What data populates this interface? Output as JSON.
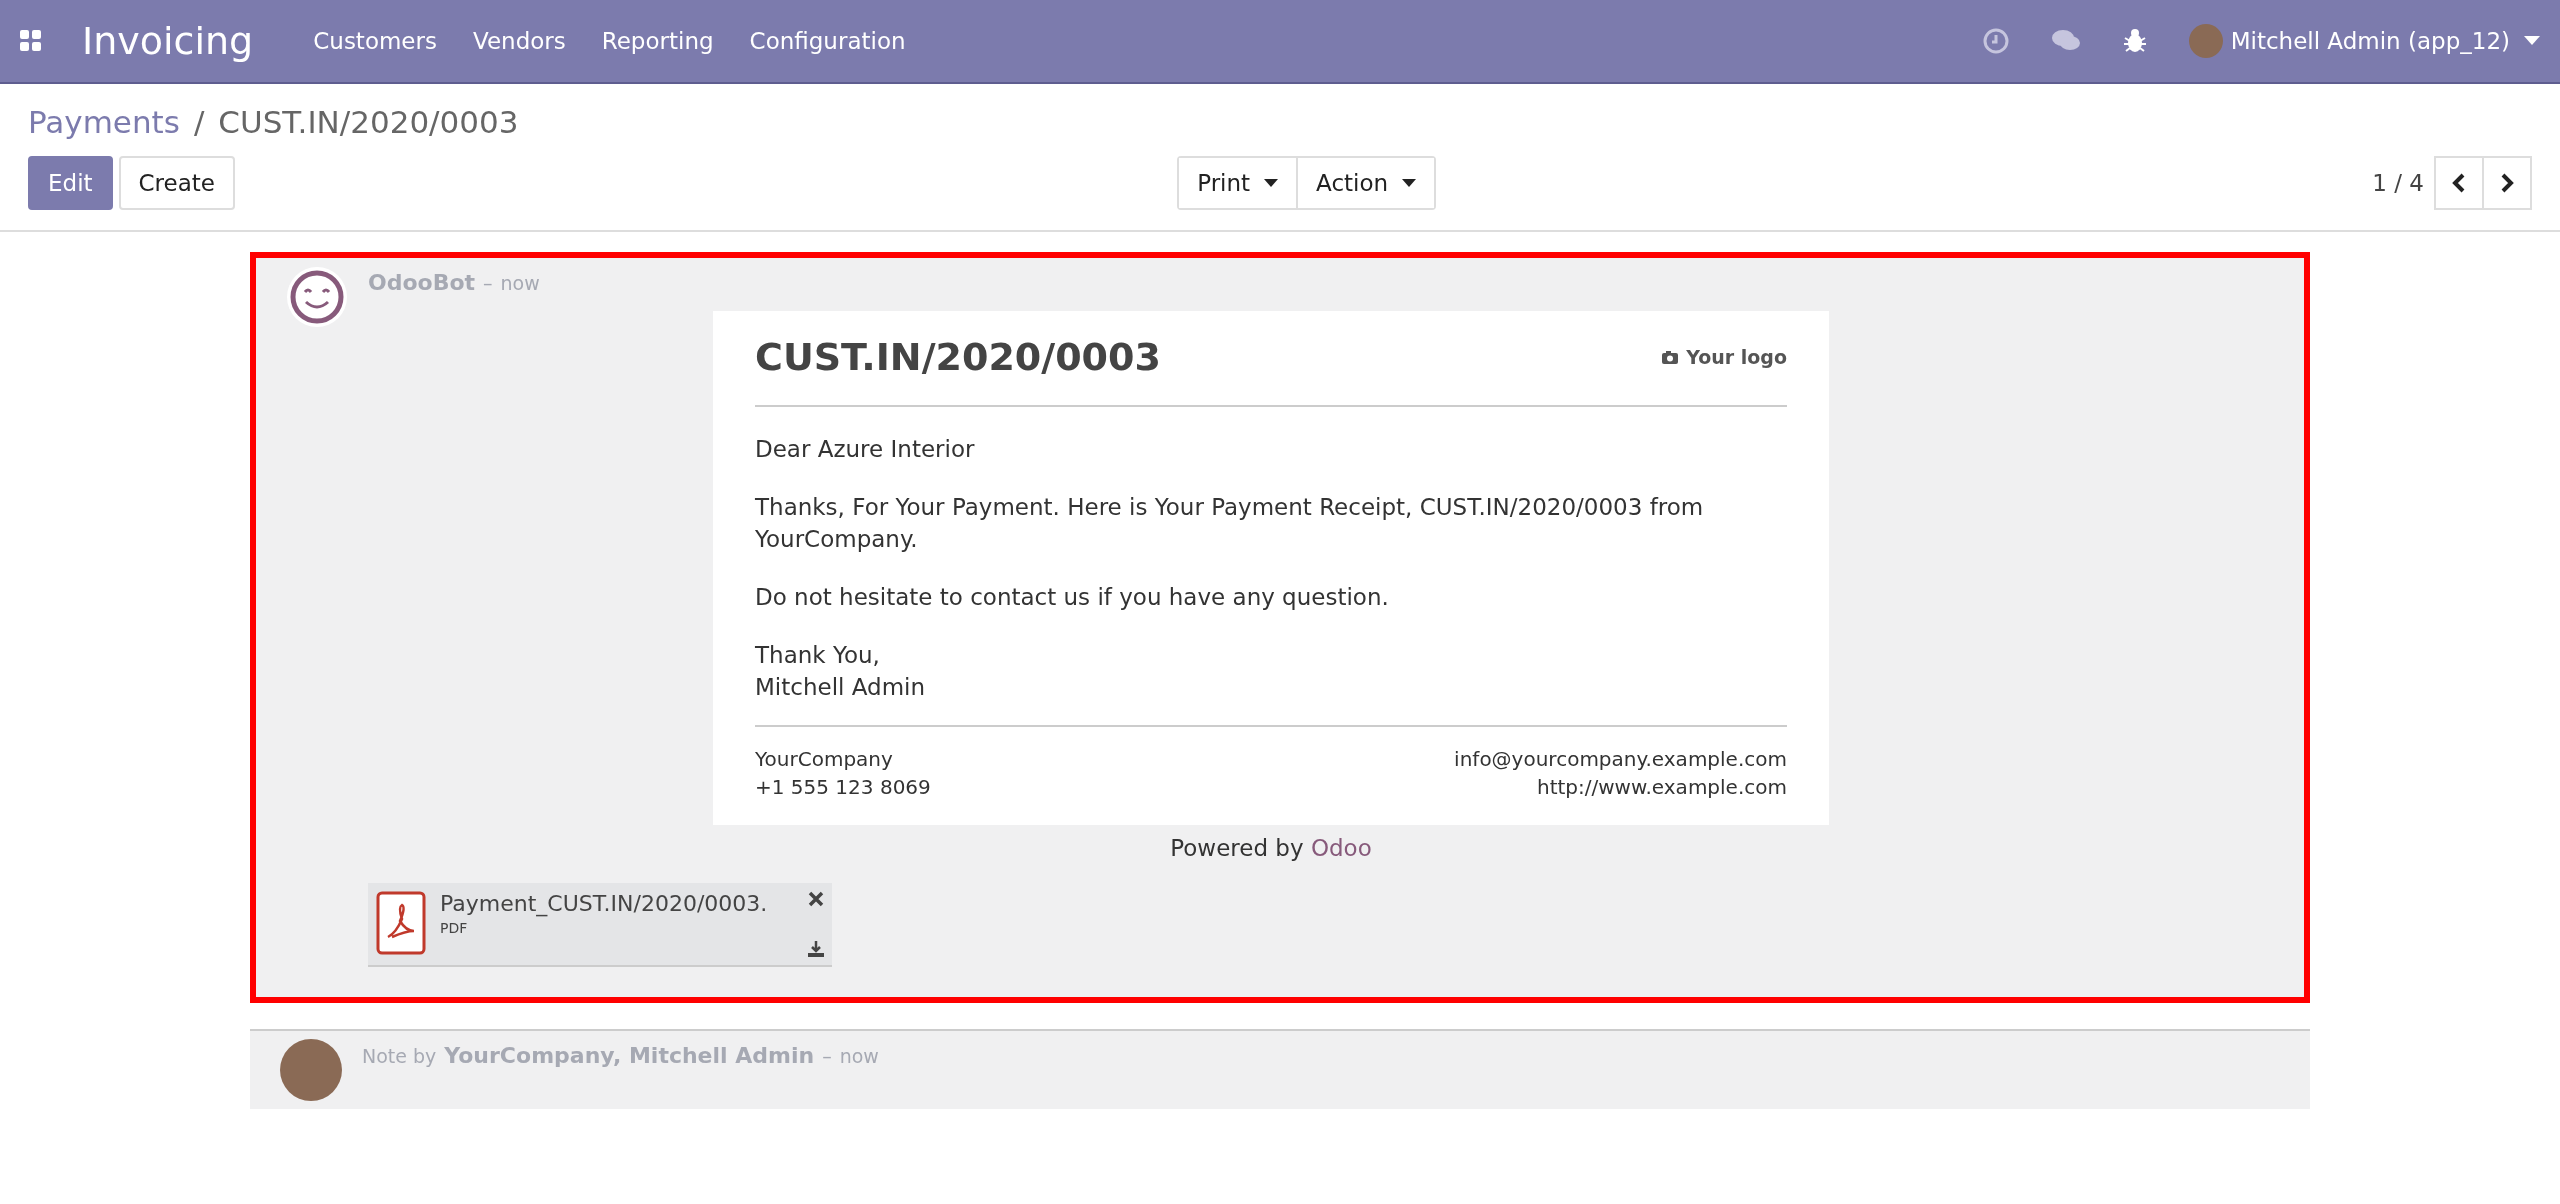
{
  "navbar": {
    "app_name": "Invoicing",
    "menu": [
      {
        "label": "Customers"
      },
      {
        "label": "Vendors"
      },
      {
        "label": "Reporting"
      },
      {
        "label": "Configuration"
      }
    ],
    "user": "Mitchell Admin (app_12)"
  },
  "breadcrumb": [
    {
      "label": "Payments",
      "kind": "link"
    },
    {
      "label": "/",
      "kind": "separator"
    },
    {
      "label": "CUST.IN/2020/0003",
      "kind": "current"
    }
  ],
  "buttons": [
    {
      "label": "Edit",
      "kind": "primary"
    },
    {
      "label": "Create",
      "kind": "secondary"
    }
  ],
  "dropdowns": [
    {
      "label": "Print"
    },
    {
      "label": "Action"
    }
  ],
  "pager": "1 / 4",
  "messages": [
    {
      "author": "OdooBot",
      "separator": "–",
      "date": "now",
      "kind": "bot",
      "highlighted": true,
      "email": {
        "title": "CUST.IN/2020/0003",
        "logo": "Your logo",
        "paragraphs": [
          "Dear Azure Interior",
          "Thanks, For Your Payment. Here is Your Payment Receipt, CUST.IN/2020/0003 from YourCompany.",
          "Do not hesitate to contact us if you have any question.",
          "Thank You,\nMitchell Admin"
        ],
        "footer_left": [
          "YourCompany",
          "+1 555 123 8069"
        ],
        "footer_right": [
          "info@yourcompany.example.com",
          "http://www.example.com"
        ]
      },
      "powered_by": "Powered by",
      "powered_link": "Odoo",
      "attachment": {
        "name": "Payment_CUST.IN/2020/0003.",
        "type": "PDF"
      }
    },
    {
      "author": "YourCompany, Mitchell Admin",
      "prefix": "Note by",
      "separator": "–",
      "date": "now",
      "kind": "note",
      "highlighted": false
    }
  ]
}
